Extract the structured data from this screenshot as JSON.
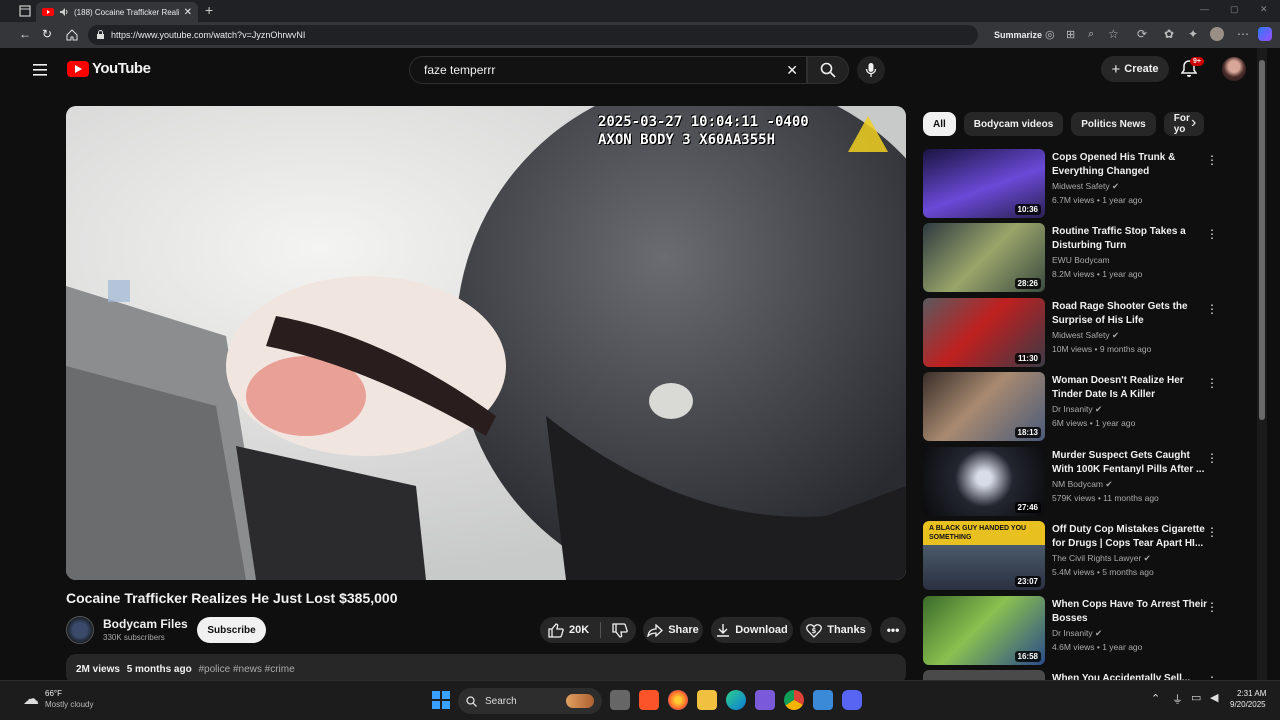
{
  "browser": {
    "tab_title": "(188) Cocaine Trafficker Reali",
    "url": "https://www.youtube.com/watch?v=JyznOhrwvNI",
    "summarize_label": "Summarize"
  },
  "masthead": {
    "logo_text": "YouTube",
    "search_value": "faze temperrr",
    "create_label": "Create",
    "notification_count": "9+"
  },
  "video": {
    "timestamp_overlay": "2025-03-27 10:04:11 -0400",
    "device_overlay": "AXON BODY 3 X60AA355H",
    "title": "Cocaine Trafficker Realizes He Just Lost $385,000",
    "channel": "Bodycam Files",
    "subscribers": "330K subscribers",
    "subscribe_label": "Subscribe",
    "likes": "20K",
    "share_label": "Share",
    "download_label": "Download",
    "thanks_label": "Thanks",
    "views": "2M views",
    "age": "5 months ago",
    "hashtags": "#police #news #crime"
  },
  "chips": [
    "All",
    "Bodycam videos",
    "Politics News",
    "For yo"
  ],
  "recommendations": [
    {
      "title": "Cops Opened His Trunk & Everything Changed",
      "channel": "Midwest Safety",
      "meta": "6.7M views • 1 year ago",
      "duration": "10:36",
      "verified": true
    },
    {
      "title": "Routine Traffic Stop Takes a Disturbing Turn",
      "channel": "EWU Bodycam",
      "meta": "8.2M views • 1 year ago",
      "duration": "28:26",
      "verified": false
    },
    {
      "title": "Road Rage Shooter Gets the Surprise of His Life",
      "channel": "Midwest Safety",
      "meta": "10M views • 9 months ago",
      "duration": "11:30",
      "verified": true
    },
    {
      "title": "Woman Doesn't Realize Her Tinder Date Is A Killer",
      "channel": "Dr Insanity",
      "meta": "6M views • 1 year ago",
      "duration": "18:13",
      "verified": true
    },
    {
      "title": "Murder Suspect Gets Caught With 100K Fentanyl Pills After ...",
      "channel": "NM Bodycam",
      "meta": "579K views • 11 months ago",
      "duration": "27:46",
      "verified": true
    },
    {
      "title": "Off Duty Cop Mistakes Cigarette for Drugs | Cops Tear Apart HI...",
      "channel": "The Civil Rights Lawyer",
      "meta": "5.4M views • 5 months ago",
      "duration": "23:07",
      "verified": true,
      "thumb_text": "A BLACK GUY HANDED YOU SOMETHING"
    },
    {
      "title": "When Cops Have To Arrest Their Bosses",
      "channel": "Dr Insanity",
      "meta": "4.6M views • 1 year ago",
      "duration": "16:58",
      "verified": true
    },
    {
      "title": "When You Accidentally Sell...",
      "channel": "",
      "meta": "",
      "duration": "",
      "verified": false
    }
  ],
  "taskbar": {
    "weather_temp": "66°F",
    "weather_desc": "Mostly cloudy",
    "search_label": "Search",
    "time": "2:31 AM",
    "date": "9/20/2025"
  },
  "colors": {
    "yt_red": "#ff0000",
    "background": "#0f0f0f",
    "surface": "#272727",
    "secondary_text": "#aaaaaa"
  }
}
